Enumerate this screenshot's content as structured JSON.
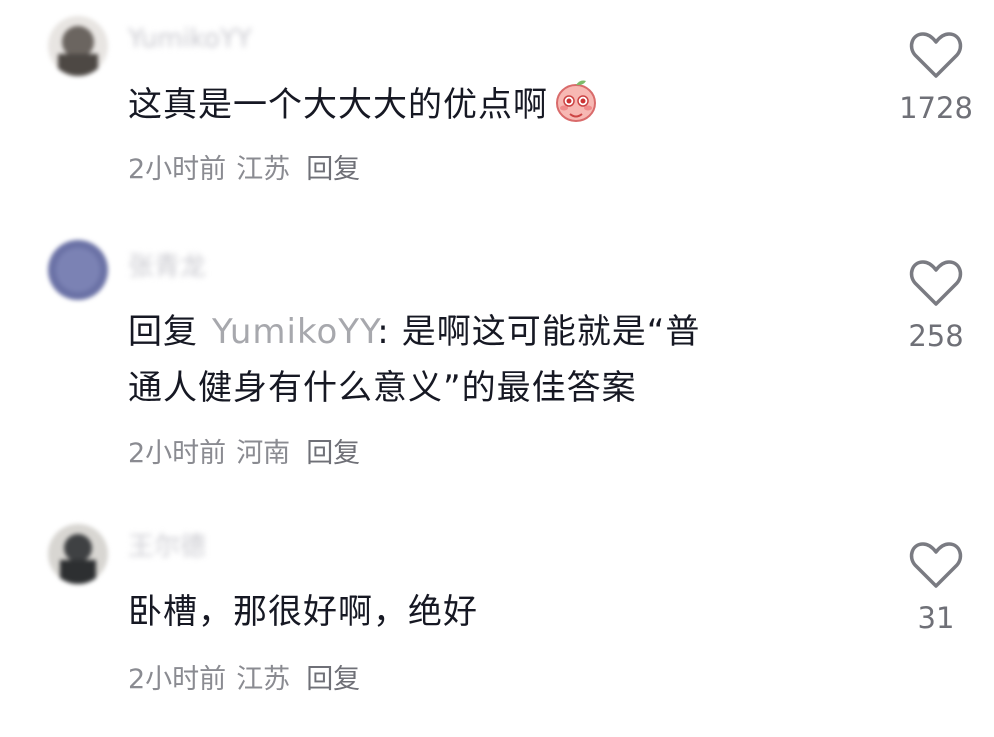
{
  "comments": [
    {
      "username": "YumikoYY",
      "text": "这真是一个大大大的优点啊",
      "emoji_icon": "blushing-peach-emoji",
      "time": "2小时前",
      "location": "江苏",
      "reply_label": "回复",
      "likes": "1728",
      "avatar_color": "#5b5652"
    },
    {
      "username": "张青龙",
      "reply_prefix": "回复",
      "reply_target": "YumikoYY",
      "reply_colon": ":",
      "text_line1": "是啊这可能就是“普",
      "text_line2": "通人健身有什么意义”的最佳答案",
      "time": "2小时前",
      "location": "河南",
      "reply_label": "回复",
      "likes": "258",
      "avatar_color": "#6b72a6"
    },
    {
      "username": "王尔德",
      "text": "卧槽，那很好啊，绝好",
      "time": "2小时前",
      "location": "江苏",
      "reply_label": "回复",
      "likes": "31",
      "avatar_color": "#3f4143"
    }
  ],
  "colors": {
    "text": "#161823",
    "muted": "#8a8b91",
    "username_blurred": "#c9c9cf",
    "heart_outline": "#7a7b82"
  }
}
